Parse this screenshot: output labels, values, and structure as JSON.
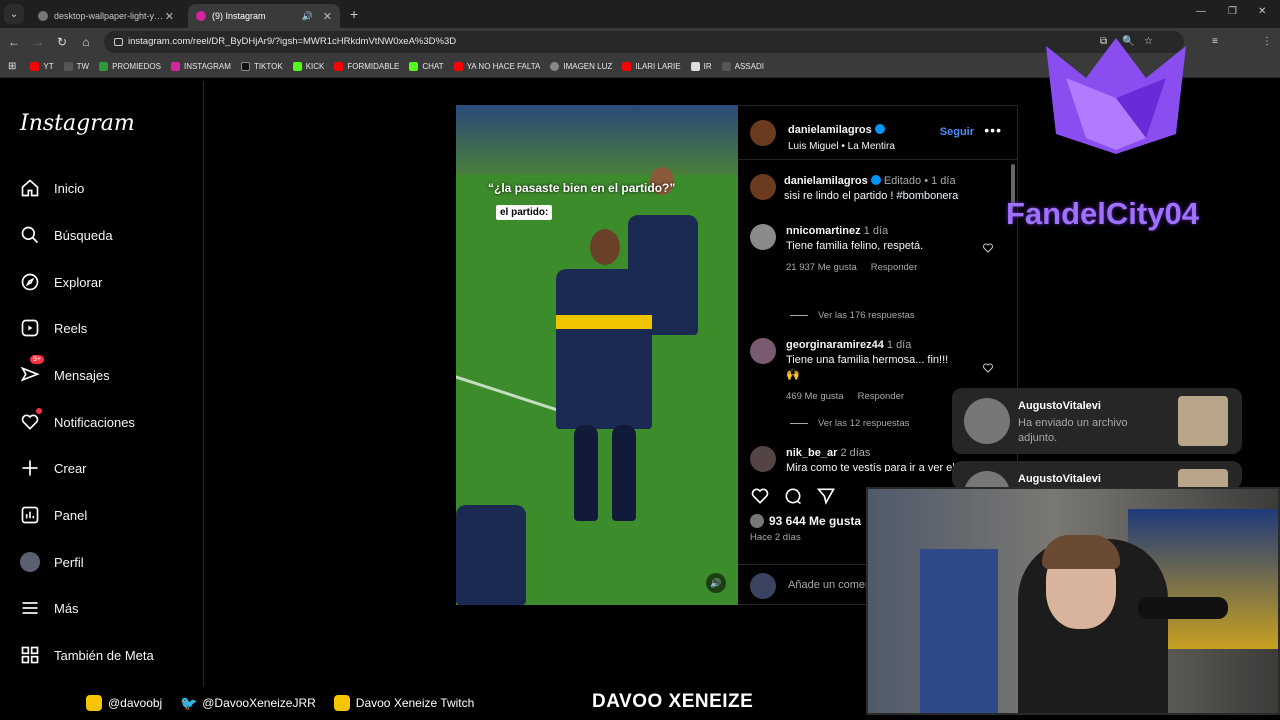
{
  "browser": {
    "tabs": [
      {
        "label": "desktop-wallpaper-light-yellow",
        "active": false
      },
      {
        "label": "(9) Instagram",
        "active": true
      }
    ],
    "url": "instagram.com/reel/DR_ByDHjAr9/?igsh=MWR1cHRkdmVtNW0xeA%3D%3D",
    "bookmarks": [
      "YT",
      "TW",
      "PROMIEDOS",
      "INSTAGRAM",
      "TIKTOK",
      "KICK",
      "FORMIDABLE",
      "CHAT",
      "YA NO HACE FALTA",
      "IMAGEN LUZ",
      "ILARI LARIE",
      "IR",
      "ASSADI"
    ]
  },
  "sidebar": {
    "logo": "Instagram",
    "items": [
      {
        "label": "Inicio",
        "icon": "home-icon"
      },
      {
        "label": "Búsqueda",
        "icon": "search-icon"
      },
      {
        "label": "Explorar",
        "icon": "compass-icon"
      },
      {
        "label": "Reels",
        "icon": "reels-icon"
      },
      {
        "label": "Mensajes",
        "icon": "messages-icon",
        "badge": "9+"
      },
      {
        "label": "Notificaciones",
        "icon": "heart-icon"
      },
      {
        "label": "Crear",
        "icon": "plus-icon"
      },
      {
        "label": "Panel",
        "icon": "dashboard-icon"
      },
      {
        "label": "Perfil",
        "icon": "avatar"
      },
      {
        "label": "Más",
        "icon": "menu-icon"
      },
      {
        "label": "También de Meta",
        "icon": "meta-icon"
      }
    ]
  },
  "post": {
    "video_caption": "“¿la pasaste bien en el partido?”",
    "video_tag": "el partido:",
    "author": "danielamilagros",
    "audio_artist": "Luis Miguel",
    "audio_song": "La Mentira",
    "follow_label": "Seguir",
    "caption": {
      "user": "danielamilagros",
      "edited": "Editado",
      "time": "1 día",
      "text": "sisi re lindo el partido ! ",
      "hashtag": "#bombonera"
    },
    "comments": [
      {
        "user": "nnicomartinez",
        "time": "1 día",
        "text": "Tiene familia felino, respetá.",
        "likes": "21 937 Me gusta",
        "reply": "Responder",
        "view_replies": "Ver las 176 respuestas"
      },
      {
        "user": "georginaramirez44",
        "time": "1 día",
        "text": "Tiene una familia hermosa... fin!!!",
        "emoji": "🙌",
        "likes": "469 Me gusta",
        "reply": "Responder",
        "view_replies": "Ver las 12 respuestas"
      },
      {
        "user": "nik_be_ar",
        "time": "2 días",
        "text": "Mira como te vestís para ir a ver el partido jajajajaja por si miraba no?"
      }
    ],
    "like_count": "93 644 Me gusta",
    "posted": "Hace 2 días",
    "add_comment_placeholder": "Añade un comentario..."
  },
  "overlay": {
    "channel_name": "FandelCity04",
    "notifications": [
      {
        "name": "AugustoVitalevi",
        "message": "Ha enviado un archivo adjunto."
      },
      {
        "name": "AugustoVitalevi",
        "message": ""
      }
    ],
    "socials": [
      {
        "label": "@davoobj",
        "icon": "instagram-icon"
      },
      {
        "label": "@DavooXeneizeJRR",
        "icon": "twitter-icon"
      },
      {
        "label": "Davoo Xeneize Twitch",
        "icon": "youtube-icon"
      }
    ],
    "streamer": "DAVOO XENEIZE"
  },
  "colors": {
    "accent_blue": "#0095f6",
    "badge_red": "#ff3040",
    "overlay_purple": "#a070ff"
  }
}
